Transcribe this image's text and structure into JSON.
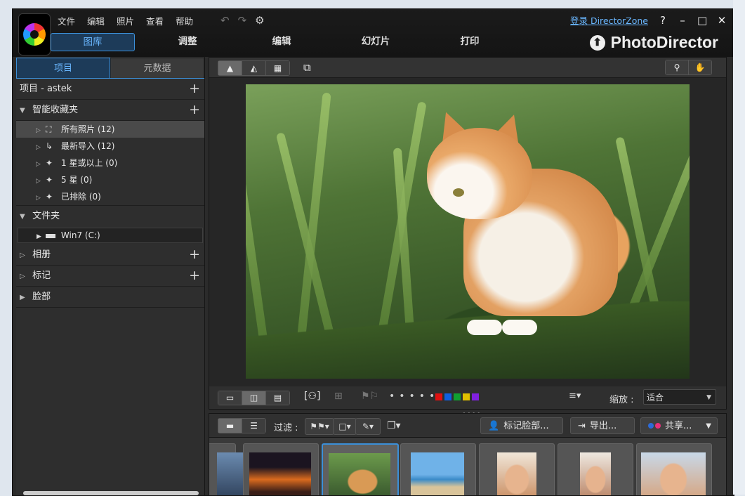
{
  "app": {
    "name": "PhotoDirector"
  },
  "menu": [
    "文件",
    "编辑",
    "照片",
    "查看",
    "帮助"
  ],
  "top_right": {
    "login": "登录 DirectorZone",
    "help": "?",
    "minimize": "–",
    "maximize": "□",
    "close": "✕"
  },
  "main_tabs": [
    "图库",
    "调整",
    "编辑",
    "幻灯片",
    "打印"
  ],
  "active_main_tab": "图库",
  "left_tabs": [
    "项目",
    "元数据"
  ],
  "project_label": "项目 - astek",
  "smart_collections": {
    "title": "智能收藏夹",
    "items": [
      {
        "label": "所有照片 (12)",
        "icon": "all-photos-icon",
        "selected": true
      },
      {
        "label": "最新导入 (12)",
        "icon": "import-icon"
      },
      {
        "label": "1 星或以上 (0)",
        "icon": "magic-wand-icon"
      },
      {
        "label": "5 星 (0)",
        "icon": "magic-wand-icon"
      },
      {
        "label": "已排除 (0)",
        "icon": "magic-wand-icon"
      }
    ]
  },
  "folders": {
    "title": "文件夹",
    "items": [
      {
        "label": "Win7 (C:)"
      }
    ]
  },
  "albums": "相册",
  "tags": "标记",
  "faces": "脸部",
  "viewer": {
    "zoom_label": "缩放 :",
    "zoom_value": "适合"
  },
  "color_labels": [
    "#e01010",
    "#1060e0",
    "#10a030",
    "#e0c000",
    "#8020e0"
  ],
  "browser_toolbar": {
    "filter_label": "过滤 :",
    "tag_faces": "标记脸部...",
    "export": "导出...",
    "share": "共享..."
  },
  "thumbnails": [
    {
      "name": "partial-left",
      "colors": [
        "#6b8bb0",
        "#2b3c55"
      ]
    },
    {
      "name": "sunset",
      "colors": [
        "#1b1420",
        "#d96a1e"
      ]
    },
    {
      "name": "cat",
      "colors": [
        "#6c9a4c",
        "#d99a55"
      ],
      "selected": true
    },
    {
      "name": "beach",
      "colors": [
        "#6fb2e8",
        "#d9c49a"
      ]
    },
    {
      "name": "woman-smile-1",
      "colors": [
        "#f0e6d8",
        "#c98b5e"
      ]
    },
    {
      "name": "woman-smile-2",
      "colors": [
        "#eee8e0",
        "#b88060"
      ]
    },
    {
      "name": "woman-smile-3",
      "colors": [
        "#c8d8e8",
        "#d7a27a"
      ]
    }
  ]
}
